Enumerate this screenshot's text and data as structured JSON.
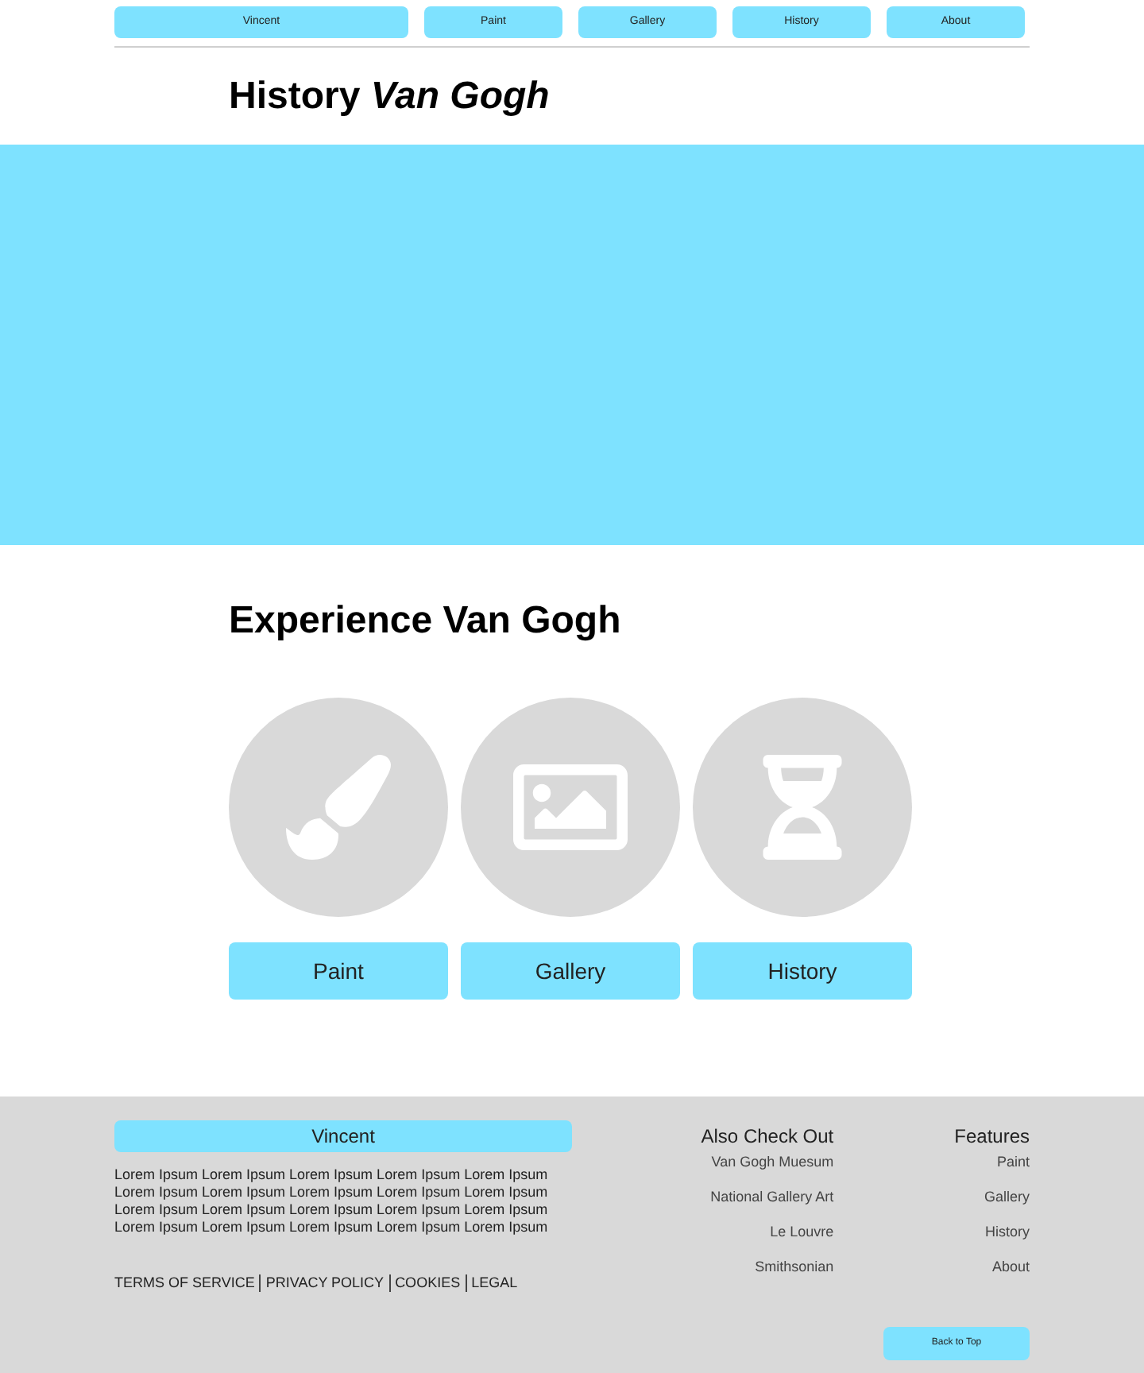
{
  "nav": [
    {
      "label": "Vincent",
      "kind": "wide"
    },
    {
      "label": "Paint",
      "kind": "normal"
    },
    {
      "label": "Gallery",
      "kind": "normal"
    },
    {
      "label": "History",
      "kind": "normal"
    },
    {
      "label": "About",
      "kind": "normal"
    }
  ],
  "page_title": "History *Van Gogh*",
  "experience": {
    "title": "Experience Van Gogh",
    "cards": [
      {
        "kind": "brush",
        "label": "Paint"
      },
      {
        "kind": "image",
        "label": "Gallery"
      },
      {
        "kind": "hourglass",
        "label": "History"
      }
    ]
  },
  "footer": {
    "brand": "Vincent",
    "text_lines": [
      "Lorem Ipsum Lorem Ipsum Lorem Ipsum Lorem Ipsum Lorem Ipsum",
      "Lorem Ipsum Lorem Ipsum Lorem Ipsum Lorem Ipsum Lorem Ipsum",
      "Lorem Ipsum Lorem Ipsum Lorem Ipsum Lorem Ipsum Lorem Ipsum",
      "Lorem Ipsum Lorem Ipsum Lorem Ipsum Lorem Ipsum Lorem Ipsum"
    ],
    "legal": [
      "TERMS OF SERVICE",
      "PRIVACY POLICY",
      "COOKIES",
      "LEGAL"
    ],
    "columns": [
      {
        "title": "Also Check Out",
        "links": [
          "Van Gogh Muesum",
          "National Gallery Art",
          "Le Louvre",
          "Smithsonian"
        ]
      },
      {
        "title": "Features",
        "links": [
          "Paint",
          "Gallery",
          "History",
          "About"
        ]
      }
    ],
    "back_to_top": "Back to Top"
  }
}
